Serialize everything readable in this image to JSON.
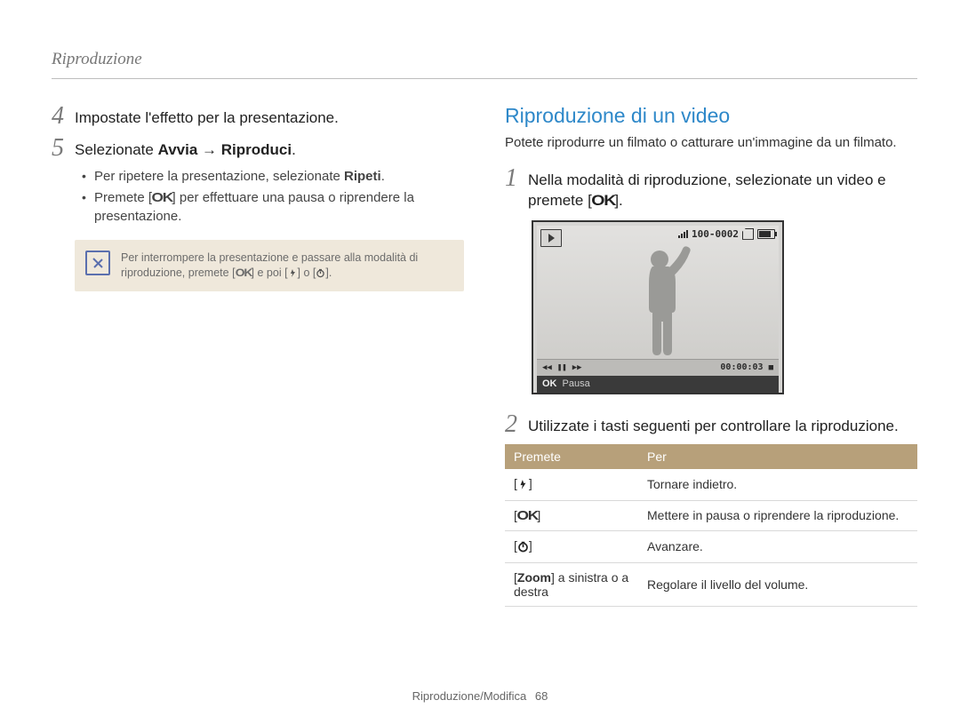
{
  "header": {
    "chapter": "Riproduzione"
  },
  "left": {
    "step4": {
      "num": "4",
      "text": "Impostate l'effetto per la presentazione."
    },
    "step5": {
      "num": "5",
      "lead": "Selezionate ",
      "bold1": "Avvia",
      "arrow": " → ",
      "bold2": "Riproduci",
      "trail": "."
    },
    "bullets": {
      "b1a": "Per ripetere la presentazione, selezionate ",
      "b1b": "Ripeti",
      "b1c": ".",
      "b2a": "Premete [",
      "b2b": "] per effettuare una pausa o riprendere la presentazione."
    },
    "note": {
      "line1": "Per interrompere la presentazione e passare alla modalità di riproduzione, premete [",
      "mid1": "] e poi [",
      "mid2": "] o [",
      "end": "]."
    }
  },
  "right": {
    "title": "Riproduzione di un video",
    "intro": "Potete riprodurre un filmato o catturare un'immagine da un filmato.",
    "step1": {
      "num": "1",
      "a": "Nella modalità di riproduzione, selezionate un video e premete [",
      "b": "]."
    },
    "lcd": {
      "counter": "100-0002",
      "time": "00:00:03",
      "hint_ok": "OK",
      "hint_text": "Pausa"
    },
    "step2": {
      "num": "2",
      "text": "Utilizzate i tasti seguenti per controllare la riproduzione."
    },
    "table": {
      "h1": "Premete",
      "h2": "Per",
      "r1c2": "Tornare indietro.",
      "r2c2": "Mettere in pausa o riprendere la riproduzione.",
      "r3c2": "Avanzare.",
      "r4c1a": "[",
      "r4c1b": "Zoom",
      "r4c1c": "] a sinistra o a destra",
      "r4c2": "Regolare il livello del volume."
    }
  },
  "footer": {
    "section": "Riproduzione/Modifica",
    "page": "68"
  }
}
